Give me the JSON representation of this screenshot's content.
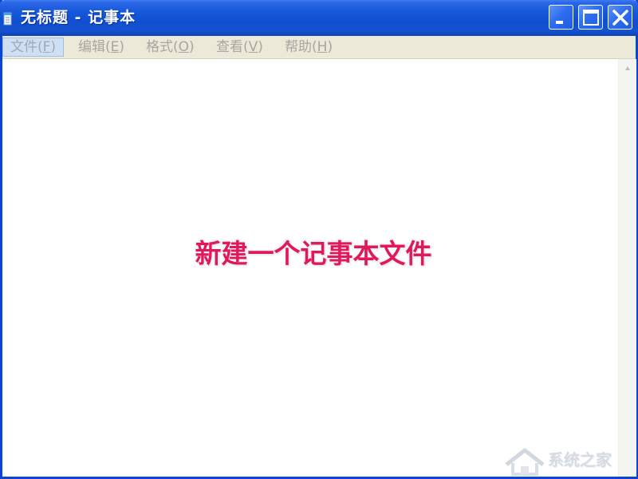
{
  "window": {
    "title": "无标题 - 记事本",
    "controls": {
      "minimize": "minimize",
      "maximize": "maximize",
      "close": "close"
    }
  },
  "menu": {
    "items": [
      {
        "label": "文件(",
        "mnemonic": "F",
        "suffix": ")"
      },
      {
        "label": "编辑(",
        "mnemonic": "E",
        "suffix": ")"
      },
      {
        "label": "格式(",
        "mnemonic": "O",
        "suffix": ")"
      },
      {
        "label": "查看(",
        "mnemonic": "V",
        "suffix": ")"
      },
      {
        "label": "帮助(",
        "mnemonic": "H",
        "suffix": ")"
      }
    ]
  },
  "annotation": {
    "text": "新建一个记事本文件",
    "color": "#e0185c"
  },
  "watermark": {
    "text": "系统之家"
  },
  "icons": {
    "app": "notepad-icon",
    "scroll_up": "chevron-up-icon"
  },
  "colors": {
    "titlebar": "#1558d8",
    "menubar": "#ece9d8",
    "menu_text": "#a7a6a0"
  }
}
